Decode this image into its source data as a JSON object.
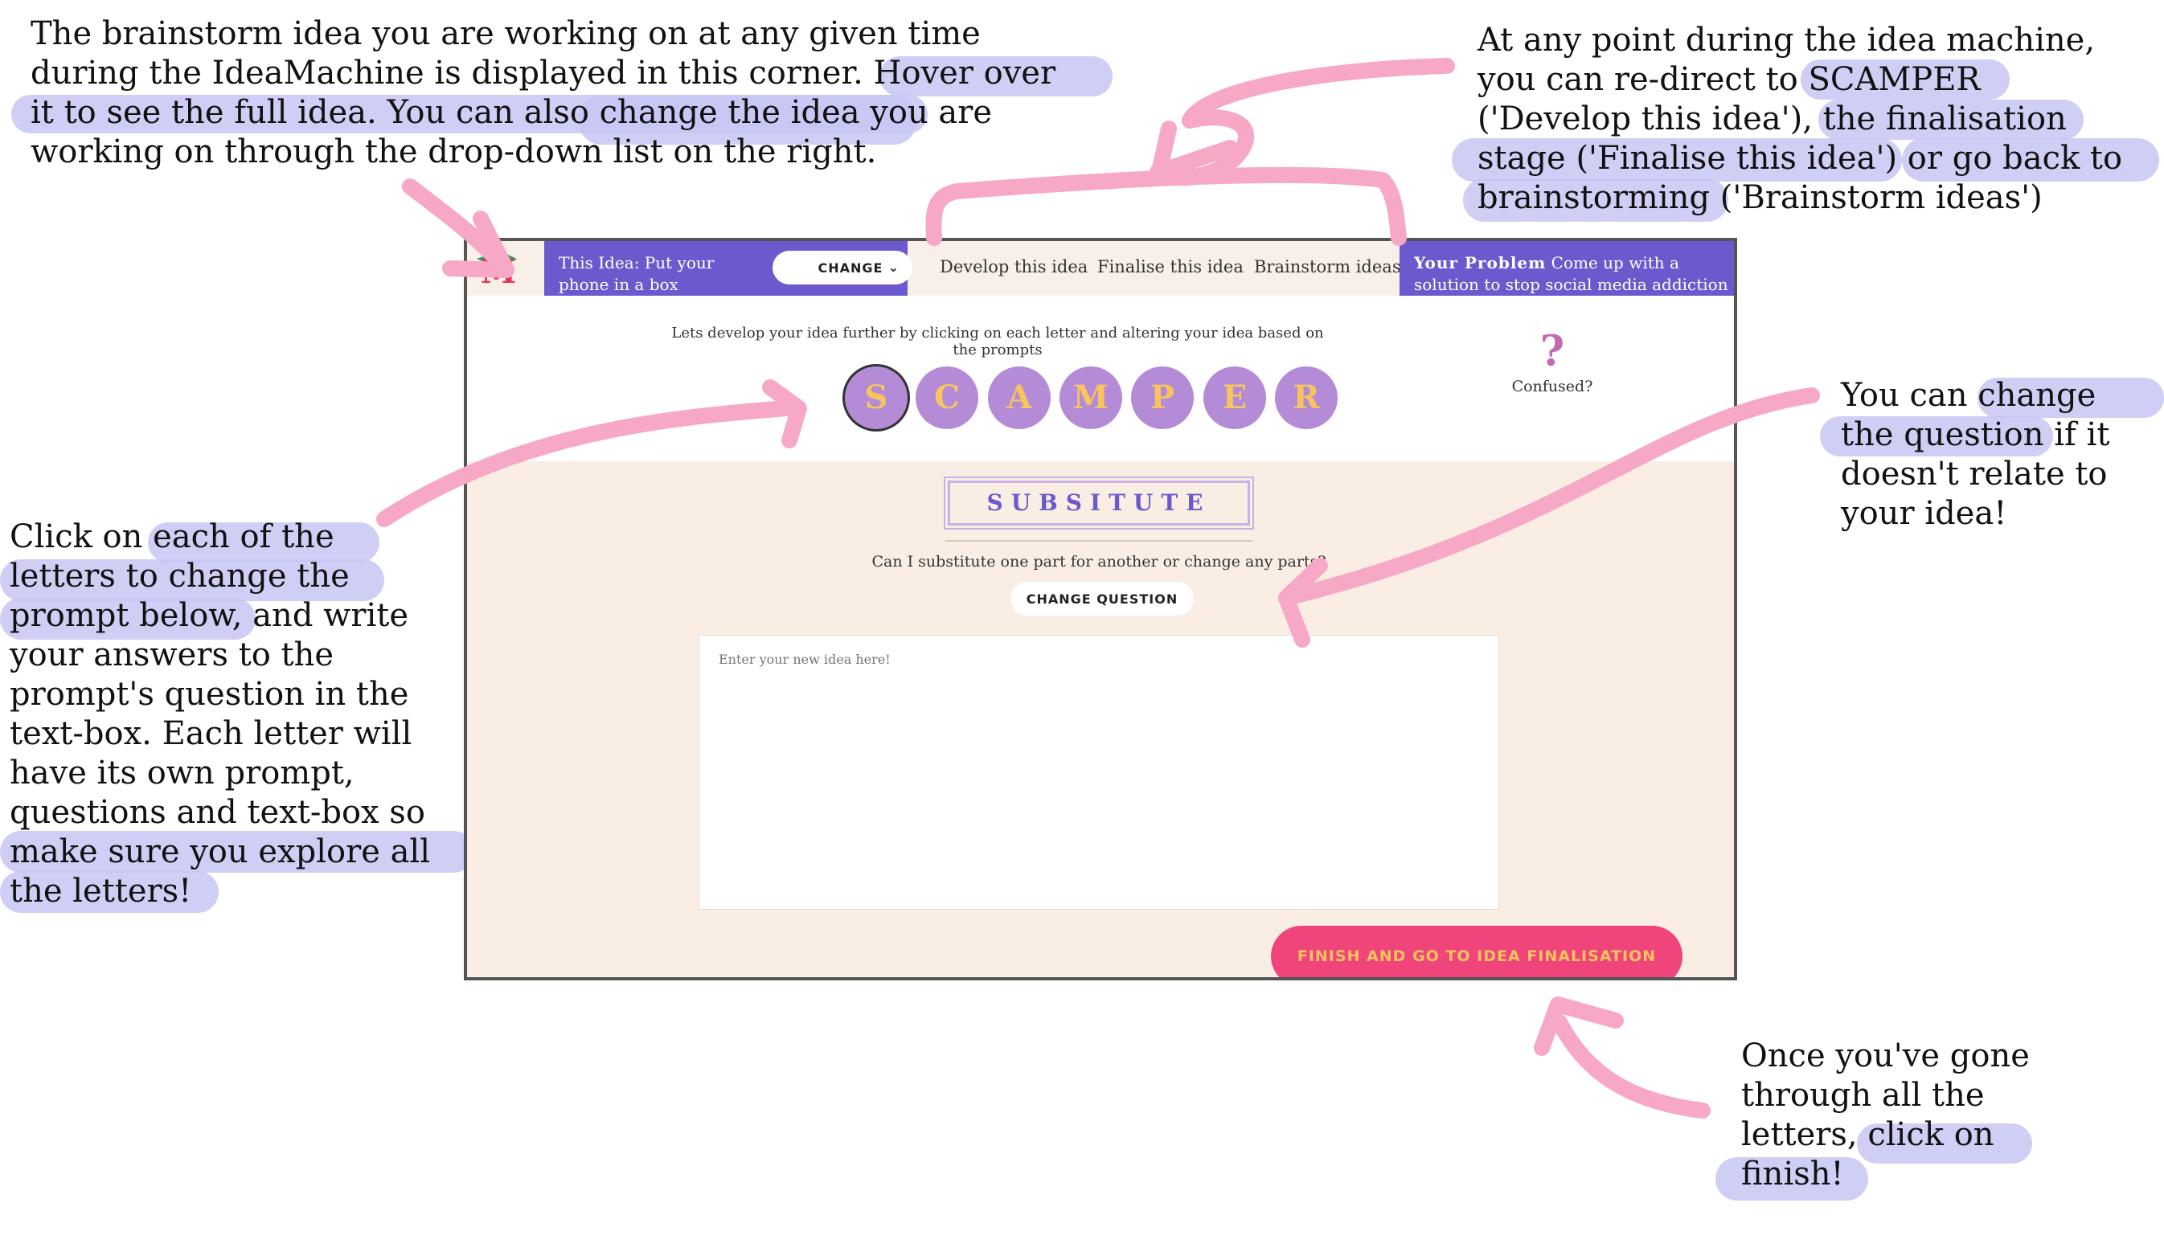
{
  "app": {
    "logo_letter": "M",
    "current_idea": "This Idea: Put your phone in a box",
    "idea_dropdown": "CHANGE",
    "nav": [
      "Develop this idea",
      "Finalise this idea",
      "Brainstorm ideas"
    ],
    "problem_label": "Your Problem",
    "problem_text": "Come up with a solution to stop social media addiction",
    "instruction": "Lets develop your idea further by clicking on each letter and altering your idea based on the prompts",
    "letters": [
      "S",
      "C",
      "A",
      "M",
      "P",
      "E",
      "R"
    ],
    "active_letter": "S",
    "help_label": "Confused?",
    "help_icon": "question-mark-icon",
    "section_title": "SUBSITUTE",
    "question": "Can I substitute one part for another or change any parts?",
    "change_question_button": "CHANGE QUESTION",
    "input_placeholder": "Enter your new idea here!",
    "finish_button": "FINISH AND GO TO IDEA FINALISATION"
  },
  "annotations": {
    "top_left": "The brainstorm idea you are working on at any given time\nduring the IdeaMachine is displayed in this corner. Hover over\nit to see the full idea. You can also change the idea you are\nworking on through the drop-down list on the right.",
    "top_right": "At any point during the idea machine,\nyou can re-direct to SCAMPER\n('Develop this idea'), the finalisation\nstage ('Finalise this idea') or go back to\nbrainstorming ('Brainstorm ideas')",
    "left": "Click on each of the\nletters to change the\nprompt below, and write\nyour answers to the\nprompt's question in the\ntext-box. Each letter will\nhave its own prompt,\nquestions and text-box so\nmake sure you explore all\nthe letters!",
    "right": "You can change\nthe question if it\ndoesn't relate to\nyour idea!",
    "bottom_right": "Once you've gone\nthrough all the\nletters, click on\nfinish!"
  },
  "colors": {
    "purple": "#6a5acd",
    "letter_circle": "#b48bd6",
    "letter_text": "#f7c45d",
    "panel": "#faeee4",
    "finish": "#f0457a",
    "arrow": "#f7a8c7",
    "highlight": "#c7c7f3"
  }
}
